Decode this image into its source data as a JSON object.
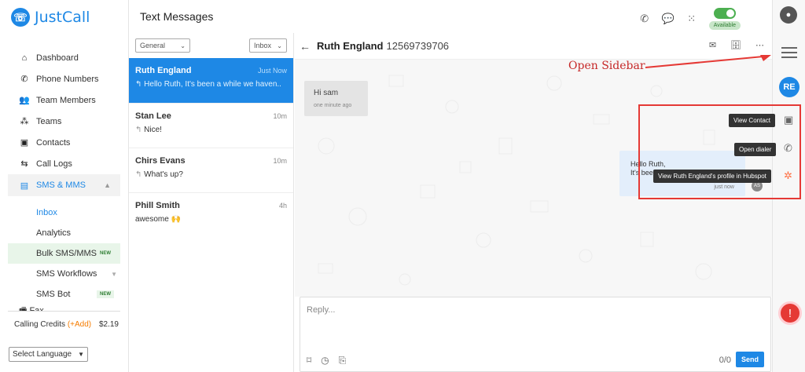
{
  "app": {
    "logo_text": "JustCall",
    "page_title": "Text Messages"
  },
  "nav": {
    "items": [
      {
        "label": "Dashboard",
        "icon": "home-icon"
      },
      {
        "label": "Phone Numbers",
        "icon": "phone-icon"
      },
      {
        "label": "Team Members",
        "icon": "team-members-icon"
      },
      {
        "label": "Teams",
        "icon": "teams-icon"
      },
      {
        "label": "Contacts",
        "icon": "contacts-icon"
      },
      {
        "label": "Call Logs",
        "icon": "call-logs-icon"
      },
      {
        "label": "SMS & MMS",
        "icon": "sms-icon"
      }
    ],
    "sub_items": [
      {
        "label": "Inbox"
      },
      {
        "label": "Analytics"
      },
      {
        "label": "Bulk SMS/MMS",
        "badge": "NEW"
      },
      {
        "label": "SMS Workflows"
      },
      {
        "label": "SMS Bot",
        "badge": "NEW"
      }
    ],
    "fax_label": "Fax"
  },
  "credits": {
    "label": "Calling Credits",
    "add_label": "(+Add)",
    "amount": "$2.19"
  },
  "language": {
    "selected": "Select Language"
  },
  "topbar": {
    "status_label": "Available"
  },
  "filters": {
    "folder": "General",
    "box": "Inbox"
  },
  "conversations": [
    {
      "name": "Ruth England",
      "time": "Just Now",
      "preview": "Hello Ruth, It's been a while we haven.."
    },
    {
      "name": "Stan Lee",
      "time": "10m",
      "preview": "Nice!"
    },
    {
      "name": "Chirs Evans",
      "time": "10m",
      "preview": "What's up?"
    },
    {
      "name": "Phill Smith",
      "time": "4h",
      "preview": "awesome 🙌"
    }
  ],
  "chat": {
    "contact_name": "Ruth England",
    "contact_number": "12569739706",
    "incoming": {
      "text": "Hi sam",
      "time": "one minute ago"
    },
    "outgoing": {
      "line1": "Hello Ruth,",
      "line2": "It's been a while we haven't met",
      "time": "just now",
      "sender_initials": "AS"
    },
    "reply_placeholder": "Reply...",
    "char_count": "0/0",
    "send_label": "Send"
  },
  "rail": {
    "contact_initials": "RE"
  },
  "tooltips": {
    "view_contact": "View Contact",
    "open_dialer": "Open dialer",
    "hubspot": "View Ruth England's profile in Hubspot"
  },
  "annotation": {
    "text": "Open Sidebar",
    "color": "#e53935"
  },
  "colors": {
    "accent": "#1e88e5",
    "available": "#4caf50"
  }
}
